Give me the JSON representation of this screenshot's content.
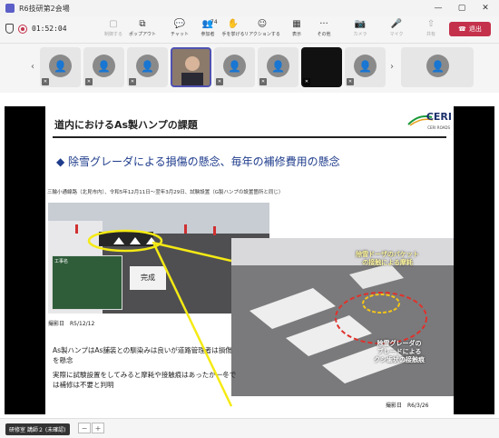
{
  "window": {
    "title": "R6技研第2会場",
    "minimize": "—",
    "maximize": "▢",
    "close": "✕"
  },
  "toolbar": {
    "timer": "01:52:04",
    "buttons": [
      {
        "label": "制御する",
        "icon": "▢"
      },
      {
        "label": "ポップアウト",
        "icon": "⧉"
      },
      {
        "label": "チャット",
        "icon": "💬"
      },
      {
        "label": "参加者",
        "icon": "👥",
        "count": "74"
      },
      {
        "label": "手を挙げる",
        "icon": "✋"
      },
      {
        "label": "リアクションする",
        "icon": "☺"
      },
      {
        "label": "表示",
        "icon": "▦"
      },
      {
        "label": "その他",
        "icon": "···"
      },
      {
        "label": "カメラ",
        "icon": "📷"
      },
      {
        "label": "マイク",
        "icon": "🎤"
      },
      {
        "label": "共有",
        "icon": "⇧"
      }
    ],
    "leave_label": "退出"
  },
  "strip": {
    "prev": "‹",
    "next": "›"
  },
  "slide": {
    "title": "道内におけるAs製ハンプの課題",
    "logo_text": "CERI",
    "logo_sub": "CERI ROADS",
    "headline": "◆ 除雪グレーダによる損傷の懸念、毎年の補修費用の懸念",
    "note": "三輪小通線路（北見市内）、令和5年12月11日～翌年3月29日、試験設置（G製ハンプの設置箇所と同じ）",
    "board_title": "工事名",
    "kansei": "完成",
    "photo1_date": "撮影日　R5/12/12",
    "photo2_date": "撮影日　R6/3/26",
    "label_top": "除雪ドーザのバケット\nの接触による摩耗",
    "label_bottom": "除雪グレーダの\nブレードによる\nクシ歯状の接触痕",
    "text1": "As製ハンプはAs舗装との馴染みは良いが道路管理者は損傷を懸念",
    "text2": "実際に試験設置をしてみると摩耗や接触痕はあったが一冬では補修は不要と判明"
  },
  "footer": {
    "tag": "研修室 講師２ (未確認)",
    "minus": "−",
    "plus": "+"
  },
  "colors": {
    "accent": "#5b5fc7",
    "leave": "#c4314b",
    "slide_heading": "#1f3c8c",
    "highlight": "#f5ea14",
    "damage": "#e0312b"
  }
}
